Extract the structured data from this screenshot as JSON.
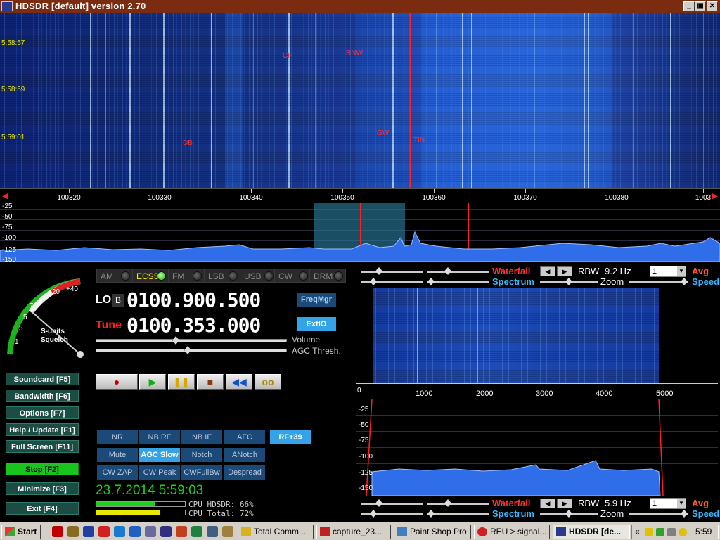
{
  "window": {
    "title": "HDSDR [default]  version 2.70",
    "controls": [
      "_",
      "▣",
      "✕"
    ]
  },
  "waterfall": {
    "times": [
      "5:58:57",
      "5:58:59",
      "5:59:01"
    ],
    "stations": [
      "CF",
      "RNW",
      "DB",
      "GW",
      "TIN"
    ]
  },
  "freq_scale": [
    "100320",
    "100330",
    "100340",
    "100350",
    "100360",
    "100370",
    "100380",
    "1003"
  ],
  "spectrum_db": [
    "-25",
    "-50",
    "-75",
    "-100",
    "-125",
    "-150"
  ],
  "smeter": {
    "scale": [
      "1",
      "3",
      "5",
      "7",
      "9",
      "+20",
      "+40"
    ],
    "labels": [
      "S-units",
      "Squelch"
    ]
  },
  "modes": [
    "AM",
    "ECSS",
    "FM",
    "LSB",
    "USB",
    "CW",
    "DRM"
  ],
  "active_mode": "ECSS",
  "lo": {
    "label": "LO",
    "badge": "B",
    "value": "0100.900.500"
  },
  "tune": {
    "label": "Tune",
    "value": "0100.353.000"
  },
  "buttons": {
    "freqmgr": "FreqMgr",
    "extio": "ExtIO"
  },
  "sliders": {
    "volume": "Volume",
    "agc": "AGC Thresh."
  },
  "left_buttons": [
    "Soundcard  [F5]",
    "Bandwidth  [F6]",
    "Options  [F7]",
    "Help / Update  [F1]",
    "Full Screen  [F11]",
    "Stop          [F2]",
    "Minimize  [F3]",
    "Exit         [F4]"
  ],
  "playback": [
    "●",
    "▶",
    "❚❚",
    "■",
    "◀◀",
    "oo"
  ],
  "function_buttons": [
    [
      "NR",
      "NB RF",
      "NB IF",
      "AFC",
      "RF+39"
    ],
    [
      "Mute",
      "AGC Slow",
      "Notch",
      "ANotch"
    ],
    [
      "CW ZAP",
      "CW Peak",
      "CWFullBw",
      "Despread"
    ]
  ],
  "datetime": "23.7.2014  5:59:03",
  "cpu": {
    "hdsdr_label": "CPU HDSDR:  66%",
    "total_label": "CPU Total:  72%",
    "hdsdr": 0.66,
    "total": 0.72
  },
  "right_top": {
    "waterfall": "Waterfall",
    "spectrum": "Spectrum",
    "rbw": "RBW",
    "rbw_value": "9.2 Hz",
    "zoom": "Zoom",
    "avg_value": "1",
    "avg": "Avg",
    "speed": "Speed"
  },
  "sub_scale": [
    "0",
    "1000",
    "2000",
    "3000",
    "4000",
    "5000"
  ],
  "sub_db": [
    "-25",
    "-50",
    "-75",
    "-100",
    "-125",
    "-150"
  ],
  "right_bottom": {
    "waterfall": "Waterfall",
    "spectrum": "Spectrum",
    "rbw": "RBW",
    "rbw_value": "5.9 Hz",
    "zoom": "Zoom",
    "avg_value": "1",
    "avg": "Avg",
    "speed": "Speed"
  },
  "taskbar": {
    "start": "Start",
    "items": [
      "Total Comm...",
      "capture_23...",
      "Paint Shop Pro",
      "REU > signal...",
      "HDSDR [de..."
    ],
    "clock": "5:59",
    "chevron": "«"
  },
  "colors": {
    "title_bg": "#7a2b10",
    "button_teal": "#1c4d45",
    "stop_green": "#19c41d",
    "func_blue": "#1b4a78",
    "func_active": "#35a3e8",
    "accent_red": "#ff3030",
    "accent_cyan": "#34b7ff"
  }
}
